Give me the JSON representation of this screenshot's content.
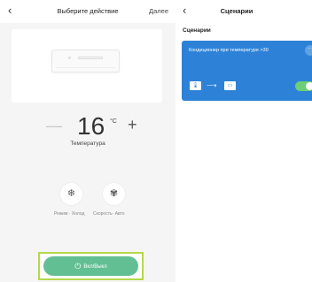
{
  "left_screen": {
    "back_icon": "‹",
    "title": "Выберите действие",
    "next_label": "Далее",
    "temperature": {
      "value": "16",
      "unit": "°C",
      "label": "Температура",
      "minus_symbol": "—",
      "plus_symbol": "+"
    },
    "mode": {
      "icon": "snowflake-icon",
      "glyph": "❄",
      "label": "Режим · Холод"
    },
    "speed": {
      "icon": "fan-icon",
      "glyph": "✾",
      "label": "Скорость· Авто"
    },
    "power_button": {
      "label": "Вкл/Выкл",
      "glyph": "⏻",
      "color": "#62bf94"
    },
    "highlight_color": "#b5d84a"
  },
  "right_screen": {
    "back_icon": "‹",
    "title": "Сценарии",
    "section_title": "Сценарии",
    "scene_card": {
      "name": "Кондиционер при температуре >30",
      "more_glyph": "···",
      "therm_glyph": "🌡",
      "arrow_glyph": "⟶",
      "ac_glyph": "▭",
      "enabled": true,
      "card_color": "#2d82d8",
      "toggle_color": "#6ccf74"
    }
  }
}
